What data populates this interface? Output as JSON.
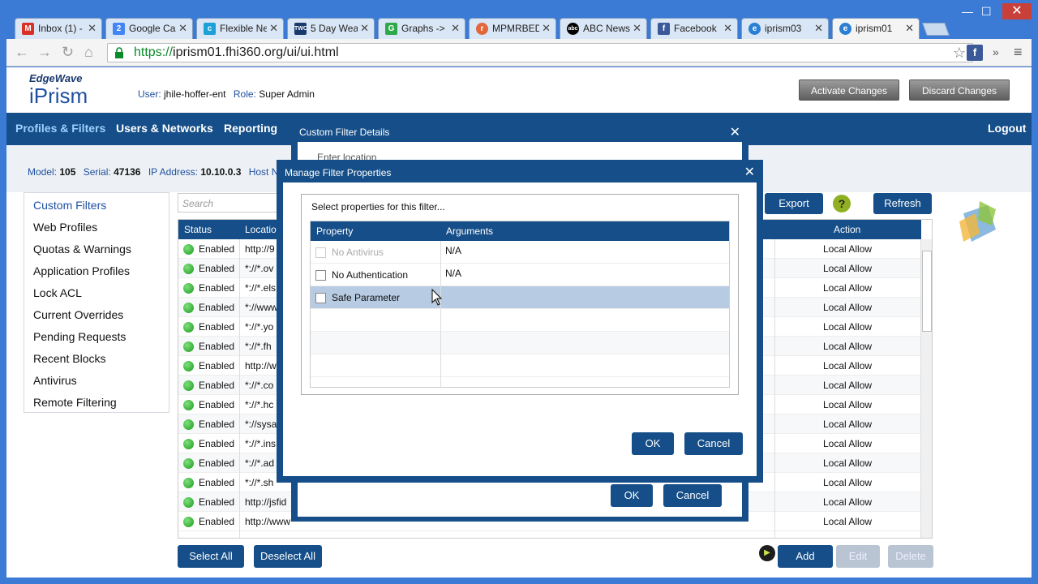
{
  "browser": {
    "tabs": [
      {
        "label": "Inbox (1) -",
        "icon_color": "#d93025",
        "icon_text": "M"
      },
      {
        "label": "Google Ca",
        "icon_color": "#4285f4",
        "icon_text": "2"
      },
      {
        "label": "Flexible Ne",
        "icon_color": "#1ba0d7",
        "icon_text": "c"
      },
      {
        "label": "5 Day Wea",
        "icon_color": "#1a3a6e",
        "icon_text": "TWC"
      },
      {
        "label": "Graphs ->",
        "icon_color": "#2ea84a",
        "icon_text": "G"
      },
      {
        "label": "MPMRBED",
        "icon_color": "#e2683c",
        "icon_text": "r"
      },
      {
        "label": "ABC News",
        "icon_color": "#000000",
        "icon_text": "abc"
      },
      {
        "label": "Facebook",
        "icon_color": "#3b5998",
        "icon_text": "f"
      },
      {
        "label": "iprism03",
        "icon_color": "#2a7fd4",
        "icon_text": "e"
      },
      {
        "label": "iprism01",
        "icon_color": "#2a7fd4",
        "icon_text": "e"
      }
    ],
    "url_scheme": "https://",
    "url_rest": "iprism01.fhi360.org/ui/ui.html",
    "ext_fb": "f",
    "overflow": "»",
    "menu": "≡",
    "wctl_min": "—",
    "wctl_max": "☐",
    "wctl_close": "✕",
    "tab_close": "✕"
  },
  "header": {
    "logo_small": "EdgeWave",
    "logo_big": "iPrism",
    "user_label": "User:",
    "user_value": "jhile-hoffer-ent",
    "role_label": "Role:",
    "role_value": "Super Admin",
    "activate_btn": "Activate Changes",
    "discard_btn": "Discard Changes"
  },
  "nav": {
    "profiles": "Profiles & Filters",
    "users": "Users & Networks",
    "reporting": "Reporting",
    "logout": "Logout"
  },
  "info": {
    "model_label": "Model:",
    "model_value": "105",
    "serial_label": "Serial:",
    "serial_value": "47136",
    "ip_label": "IP Address:",
    "ip_value": "10.10.0.3",
    "host_label": "Host N"
  },
  "sidebar": {
    "items": [
      "Custom Filters",
      "Web Profiles",
      "Quotas & Warnings",
      "Application Profiles",
      "Lock ACL",
      "Current Overrides",
      "Pending Requests",
      "Recent Blocks",
      "Antivirus",
      "Remote Filtering"
    ]
  },
  "main": {
    "search_placeholder": "Search",
    "export_btn": "Export",
    "help_btn": "?",
    "refresh_btn": "Refresh",
    "columns": {
      "status": "Status",
      "location": "Locatio",
      "action": "Action"
    },
    "rows": [
      {
        "status": "Enabled",
        "location": "http://9",
        "action": "Local Allow"
      },
      {
        "status": "Enabled",
        "location": "*://*.ov",
        "action": "Local Allow"
      },
      {
        "status": "Enabled",
        "location": "*://*.els",
        "action": "Local Allow"
      },
      {
        "status": "Enabled",
        "location": "*://www",
        "action": "Local Allow"
      },
      {
        "status": "Enabled",
        "location": "*://*.yo",
        "action": "Local Allow"
      },
      {
        "status": "Enabled",
        "location": "*://*.fh",
        "action": "Local Allow"
      },
      {
        "status": "Enabled",
        "location": "http://w",
        "action": "Local Allow"
      },
      {
        "status": "Enabled",
        "location": "*://*.co",
        "action": "Local Allow"
      },
      {
        "status": "Enabled",
        "location": "*://*.hc",
        "action": "Local Allow"
      },
      {
        "status": "Enabled",
        "location": "*://sysa",
        "action": "Local Allow"
      },
      {
        "status": "Enabled",
        "location": "*://*.ins",
        "action": "Local Allow"
      },
      {
        "status": "Enabled",
        "location": "*://*.ad",
        "action": "Local Allow"
      },
      {
        "status": "Enabled",
        "location": "*://*.sh",
        "action": "Local Allow"
      },
      {
        "status": "Enabled",
        "location": "http://jsfid",
        "action": "Local Allow"
      },
      {
        "status": "Enabled",
        "location": "http://www",
        "action": "Local Allow"
      }
    ],
    "select_all": "Select All",
    "deselect_all": "Deselect All",
    "add": "Add",
    "edit": "Edit",
    "delete": "Delete",
    "play": "▶"
  },
  "custom_filter_dialog": {
    "title": "Custom Filter Details",
    "close": "✕",
    "location_label": "Enter location",
    "ok": "OK",
    "cancel": "Cancel"
  },
  "manage_dialog": {
    "title": "Manage Filter Properties",
    "close": "✕",
    "instruction": "Select properties for this filter...",
    "col_property": "Property",
    "col_arguments": "Arguments",
    "properties": [
      {
        "name": "No Antivirus",
        "argument": "N/A",
        "disabled": true
      },
      {
        "name": "No Authentication",
        "argument": "N/A",
        "disabled": false
      },
      {
        "name": "Safe Parameter",
        "argument": "",
        "disabled": false
      }
    ],
    "ok": "OK",
    "cancel": "Cancel"
  }
}
